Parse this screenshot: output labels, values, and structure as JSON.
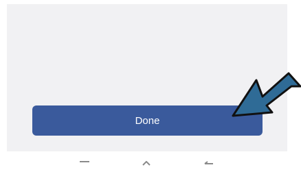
{
  "screen": {
    "done_button_label": "Done",
    "accent_color": "#3a5a9c",
    "annotation_arrow_color": "#2f6b96"
  },
  "nav_bar": {
    "icons": [
      "recent-apps-icon",
      "home-icon",
      "back-icon"
    ]
  }
}
